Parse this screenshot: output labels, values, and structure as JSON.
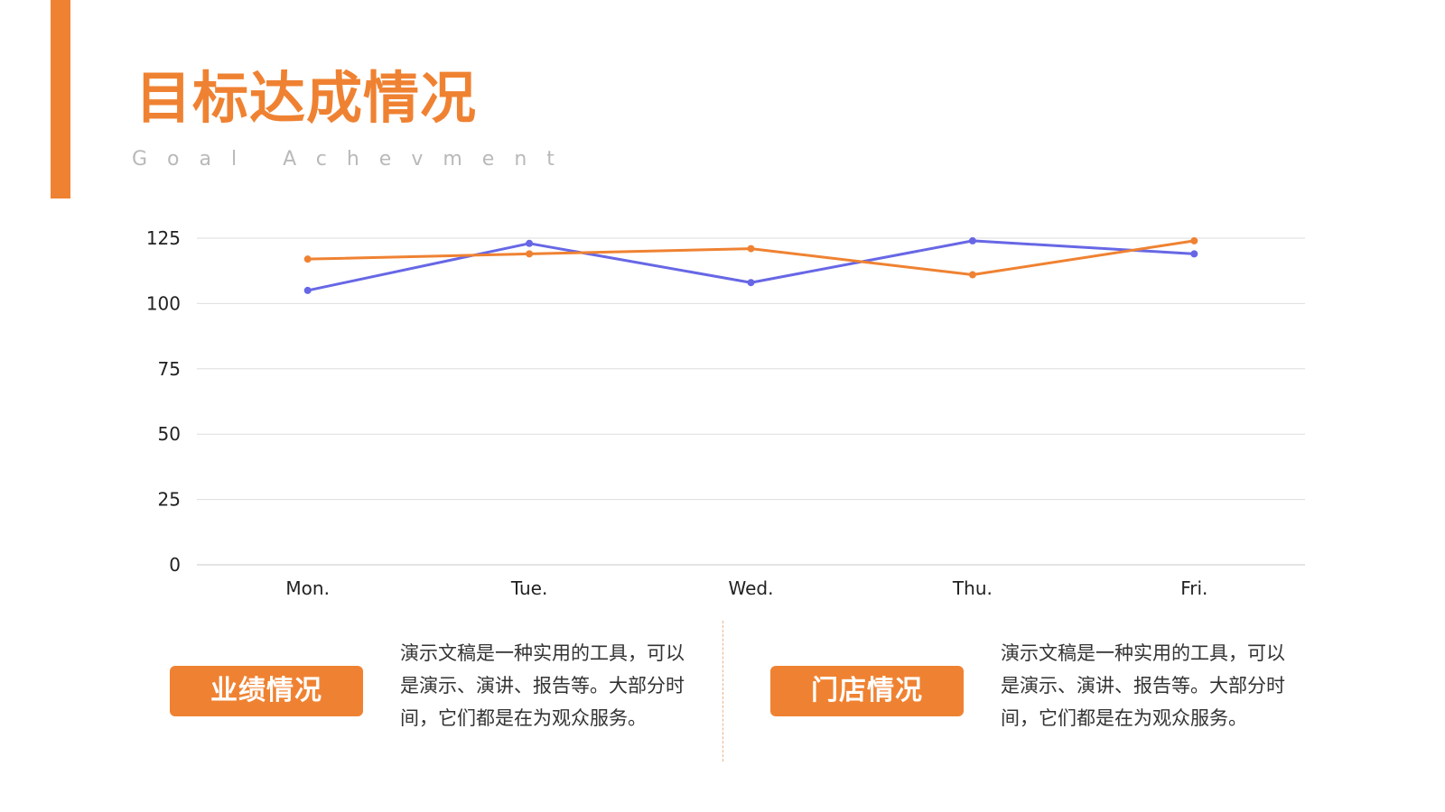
{
  "header": {
    "title": "目标达成情况",
    "subtitle": "Goal Achevment"
  },
  "colors": {
    "accent": "#ef8232",
    "series_blue": "#6767e6",
    "series_orange": "#ef8232",
    "grid": "#dddddd",
    "axis": "#c8c8c8"
  },
  "chart_data": {
    "type": "line",
    "categories": [
      "Mon.",
      "Tue.",
      "Wed.",
      "Thu.",
      "Fri."
    ],
    "series": [
      {
        "values": [
          105,
          123,
          108,
          124,
          119
        ]
      },
      {
        "values": [
          117,
          119,
          121,
          111,
          124
        ]
      }
    ],
    "y_ticks": [
      0,
      25,
      50,
      75,
      100,
      125
    ],
    "ylim": [
      0,
      125
    ],
    "grid": true,
    "legend": "none"
  },
  "panels": [
    {
      "tag": "业绩情况",
      "text": "演示文稿是一种实用的工具，可以是演示、演讲、报告等。大部分时间，它们都是在为观众服务。"
    },
    {
      "tag": "门店情况",
      "text": "演示文稿是一种实用的工具，可以是演示、演讲、报告等。大部分时间，它们都是在为观众服务。"
    }
  ]
}
